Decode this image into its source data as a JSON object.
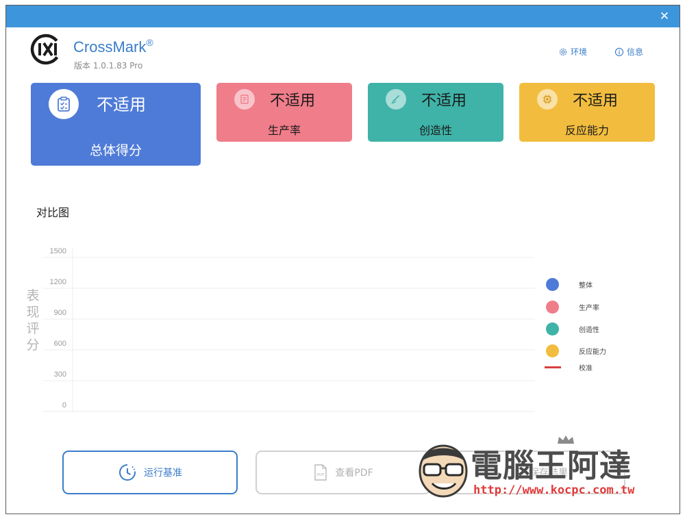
{
  "window": {
    "close_glyph": "✕"
  },
  "header": {
    "app_name": "CrossMark",
    "registered": "®",
    "version": "版本 1.0.1.83 Pro",
    "env_label": "环境",
    "info_label": "信息"
  },
  "cards": {
    "overall": {
      "score": "不适用",
      "label": "总体得分",
      "icon": "clipboard-check-icon"
    },
    "productivity": {
      "score": "不适用",
      "label": "生产率",
      "icon": "document-icon"
    },
    "creativity": {
      "score": "不适用",
      "label": "创造性",
      "icon": "brush-icon"
    },
    "responsiveness": {
      "score": "不适用",
      "label": "反应能力",
      "icon": "chip-icon"
    }
  },
  "comparison": {
    "title": "对比图"
  },
  "chart_data": {
    "type": "bar",
    "categories": [],
    "series": [],
    "ylabel": "表现评分",
    "yticks": [
      0,
      300,
      600,
      900,
      1200,
      1500
    ],
    "ylim": [
      0,
      1500
    ],
    "grid": true,
    "legend_position": "right",
    "legend": [
      {
        "label": "整体",
        "color": "#4f7bd8",
        "marker": "circle"
      },
      {
        "label": "生产率",
        "color": "#f07d8a",
        "marker": "circle"
      },
      {
        "label": "创造性",
        "color": "#3fb3a8",
        "marker": "circle"
      },
      {
        "label": "反应能力",
        "color": "#f2bd3e",
        "marker": "circle"
      },
      {
        "label": "校准",
        "color": "#d84040",
        "marker": "line"
      }
    ]
  },
  "buttons": {
    "run": "运行基准",
    "pdf": "查看PDF",
    "save": "保存结果"
  },
  "watermark": {
    "title": "電腦王阿達",
    "url": "http://www.kocpc.com.tw"
  },
  "colors": {
    "titlebar": "#3d96dc",
    "accent": "#3a7cc8",
    "overall": "#4f7bd8",
    "productivity": "#f07d8a",
    "creativity": "#3fb3a8",
    "responsiveness": "#f2bd3e"
  }
}
